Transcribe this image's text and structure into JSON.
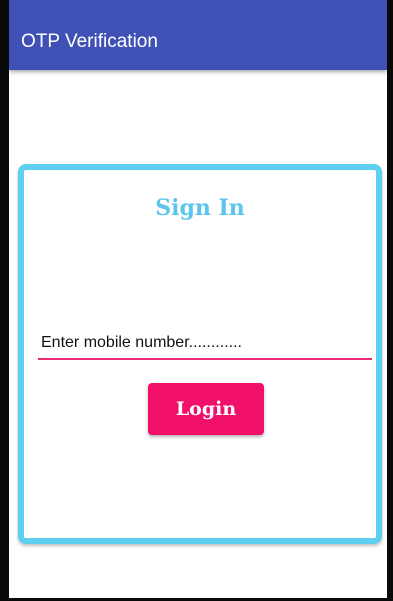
{
  "app_bar": {
    "title": "OTP Verification",
    "background_color": "#3f51b5"
  },
  "sign_in_card": {
    "title": "Sign In",
    "border_color": "#5dd0ef",
    "title_color": "#5bc5ea",
    "mobile_input": {
      "placeholder": "Enter mobile number............",
      "value": "",
      "underline_color": "#ec2b77"
    },
    "login_button": {
      "label": "Login",
      "color": "#f0106a"
    }
  }
}
